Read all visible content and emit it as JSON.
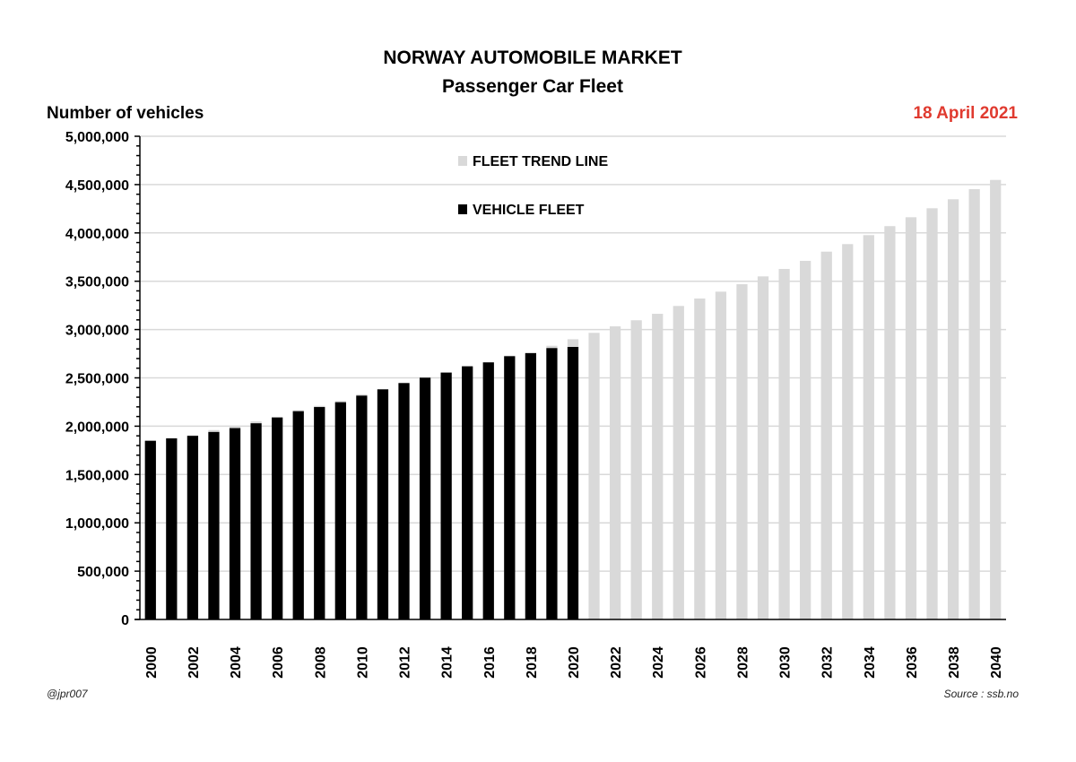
{
  "header": {
    "title": "NORWAY AUTOMOBILE MARKET",
    "subtitle": "Passenger Car Fleet",
    "ylabel": "Number of vehicles",
    "date": "18 April 2021"
  },
  "footer": {
    "credit": "@jpr007",
    "source": "Source : ssb.no"
  },
  "colors": {
    "fleet": "#000000",
    "trend": "#d9d9d9",
    "date": "#e03a2f",
    "grid": "#d9d9d9"
  },
  "chart_data": {
    "type": "bar",
    "title": "NORWAY AUTOMOBILE MARKET",
    "subtitle": "Passenger Car Fleet",
    "xlabel": "",
    "ylabel": "Number of vehicles",
    "ylim": [
      0,
      5000000
    ],
    "yticks": [
      0,
      500000,
      1000000,
      1500000,
      2000000,
      2500000,
      3000000,
      3500000,
      4000000,
      4500000,
      5000000
    ],
    "ytick_labels": [
      "0",
      "500,000",
      "1,000,000",
      "1,500,000",
      "2,000,000",
      "2,500,000",
      "3,000,000",
      "3,500,000",
      "4,000,000",
      "4,500,000",
      "5,000,000"
    ],
    "y_minor_step": 100000,
    "grid": true,
    "legend_position": "top-center",
    "categories": [
      "2000",
      "2001",
      "2002",
      "2003",
      "2004",
      "2005",
      "2006",
      "2007",
      "2008",
      "2009",
      "2010",
      "2011",
      "2012",
      "2013",
      "2014",
      "2015",
      "2016",
      "2017",
      "2018",
      "2019",
      "2020",
      "2021",
      "2022",
      "2023",
      "2024",
      "2025",
      "2026",
      "2027",
      "2028",
      "2029",
      "2030",
      "2031",
      "2032",
      "2033",
      "2034",
      "2035",
      "2036",
      "2037",
      "2038",
      "2039",
      "2040"
    ],
    "xtick_labels": [
      "2000",
      "2002",
      "2004",
      "2006",
      "2008",
      "2010",
      "2012",
      "2014",
      "2016",
      "2018",
      "2020",
      "2022",
      "2024",
      "2026",
      "2028",
      "2030",
      "2032",
      "2034",
      "2036",
      "2038",
      "2040"
    ],
    "series": [
      {
        "name": "FLEET TREND LINE",
        "color": "#d9d9d9",
        "values": [
          1850000,
          1875000,
          1905000,
          1960000,
          1995000,
          2050000,
          2095000,
          2165000,
          2210000,
          2260000,
          2330000,
          2385000,
          2450000,
          2505000,
          2560000,
          2625000,
          2665000,
          2730000,
          2765000,
          2832000,
          2900000,
          2966000,
          3033000,
          3096000,
          3163000,
          3244000,
          3321000,
          3392000,
          3469000,
          3550000,
          3627000,
          3711000,
          3806000,
          3884000,
          3977000,
          4070000,
          4162000,
          4255000,
          4348000,
          4453000,
          4548000
        ]
      },
      {
        "name": "VEHICLE FLEET",
        "color": "#000000",
        "values": [
          1849000,
          1874000,
          1900000,
          1940000,
          1980000,
          2030000,
          2090000,
          2155000,
          2198000,
          2248000,
          2316000,
          2381000,
          2446000,
          2502000,
          2554000,
          2619000,
          2660000,
          2724000,
          2755000,
          2808000,
          2820000,
          null,
          null,
          null,
          null,
          null,
          null,
          null,
          null,
          null,
          null,
          null,
          null,
          null,
          null,
          null,
          null,
          null,
          null,
          null,
          null
        ]
      }
    ]
  }
}
